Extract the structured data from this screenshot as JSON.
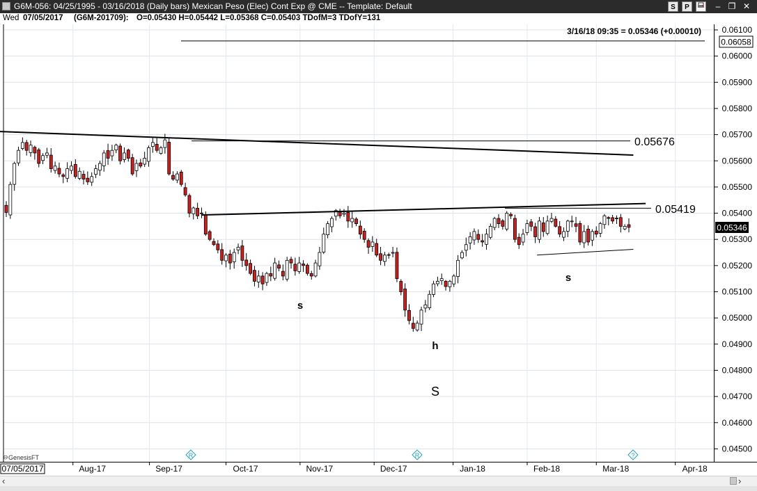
{
  "window": {
    "title": "G6M-056:  04/25/1995 - 03/16/2018  (Daily bars)    Mexican Peso (Elec) Cont Exp @ CME  --  Template: Default",
    "buttons": [
      "S",
      "P"
    ]
  },
  "infobar": {
    "day": "Wed",
    "date": "07/05/2017",
    "contract": "(G6M-201709):",
    "ohlc": "O=0.05430  H=0.05442  L=0.05368  C=0.05403  TDofM=3  TDofY=131"
  },
  "chart_data": {
    "type": "candlestick",
    "quote": "3/16/18 09:35 = 0.05346 (+0.00010)",
    "last_price_label": "0.05346",
    "top_price_label": "0.06058",
    "ylim": [
      0.0445,
      0.0612
    ],
    "y_ticks": [
      "0.06100",
      "0.06000",
      "0.05900",
      "0.05800",
      "0.05700",
      "0.05600",
      "0.05500",
      "0.05400",
      "0.05300",
      "0.05200",
      "0.05100",
      "0.05000",
      "0.04900",
      "0.04800",
      "0.04700",
      "0.04600",
      "0.04500"
    ],
    "x_tick_labels": [
      "Aug-17",
      "Sep-17",
      "Oct-17",
      "Nov-17",
      "Dec-17",
      "Jan-18",
      "Feb-18",
      "Mar-18",
      "Apr-18"
    ],
    "start_date_label": "07/05/2017",
    "watermark": "GenesisFT",
    "event_markers": [
      "R",
      "R",
      "?"
    ],
    "level_labels": [
      "0.05676",
      "0.05419"
    ],
    "pattern_labels": [
      "s",
      "h",
      "S",
      "s"
    ],
    "colors": {
      "up": "#ffffff",
      "down": "#cc2020",
      "line": "#000000"
    },
    "closes": [
      0.05403,
      0.0551,
      0.0559,
      0.0564,
      0.0567,
      0.0564,
      0.0566,
      0.0563,
      0.0559,
      0.0562,
      0.0563,
      0.0557,
      0.0558,
      0.0555,
      0.0554,
      0.0557,
      0.0558,
      0.0554,
      0.0556,
      0.0553,
      0.0552,
      0.0554,
      0.0557,
      0.0559,
      0.0563,
      0.0561,
      0.0564,
      0.0566,
      0.056,
      0.0563,
      0.0561,
      0.0555,
      0.0559,
      0.0558,
      0.0561,
      0.0565,
      0.0567,
      0.0564,
      0.0565,
      0.0568,
      0.0555,
      0.0553,
      0.0555,
      0.0551,
      0.0547,
      0.054,
      0.0542,
      0.0539,
      0.054,
      0.0532,
      0.053,
      0.0528,
      0.0526,
      0.0522,
      0.0524,
      0.0521,
      0.0525,
      0.0527,
      0.0522,
      0.052,
      0.0517,
      0.0514,
      0.0516,
      0.0513,
      0.0517,
      0.0516,
      0.0521,
      0.0519,
      0.0516,
      0.0522,
      0.0521,
      0.0518,
      0.0521,
      0.052,
      0.0517,
      0.0516,
      0.0521,
      0.0525,
      0.0532,
      0.0536,
      0.0538,
      0.0541,
      0.0539,
      0.054,
      0.0537,
      0.0538,
      0.0536,
      0.0532,
      0.053,
      0.0527,
      0.0529,
      0.0524,
      0.0522,
      0.0524,
      0.0524,
      0.0525,
      0.0515,
      0.051,
      0.0503,
      0.0499,
      0.0496,
      0.0498,
      0.0503,
      0.0505,
      0.0509,
      0.0513,
      0.0514,
      0.0515,
      0.0512,
      0.0514,
      0.0516,
      0.0522,
      0.0525,
      0.0528,
      0.0531,
      0.0533,
      0.053,
      0.0529,
      0.0532,
      0.0535,
      0.0538,
      0.0536,
      0.0535,
      0.054,
      0.0539,
      0.053,
      0.0528,
      0.0532,
      0.0536,
      0.0535,
      0.0531,
      0.0537,
      0.0533,
      0.0537,
      0.0538,
      0.0535,
      0.0532,
      0.0533,
      0.0537,
      0.0537,
      0.0535,
      0.0529,
      0.0533,
      0.0529,
      0.0533,
      0.0532,
      0.0536,
      0.0539,
      0.0538,
      0.0537,
      0.0538,
      0.0535,
      0.0535,
      0.05346
    ],
    "trendlines": [
      {
        "name": "upper neckline",
        "from": [
          "2017-07-05",
          0.05712
        ],
        "to": [
          "2018-03-16",
          0.05622
        ]
      },
      {
        "name": "neckline",
        "from": [
          "2017-09-22",
          0.05393
        ],
        "to": [
          "2018-03-21",
          0.05437
        ]
      },
      {
        "name": "right shoulder support",
        "from": [
          "2018-02-05",
          0.0524
        ],
        "to": [
          "2018-03-16",
          0.05262
        ]
      }
    ],
    "horizontal_levels": [
      0.06058,
      0.05676,
      0.05419
    ]
  }
}
